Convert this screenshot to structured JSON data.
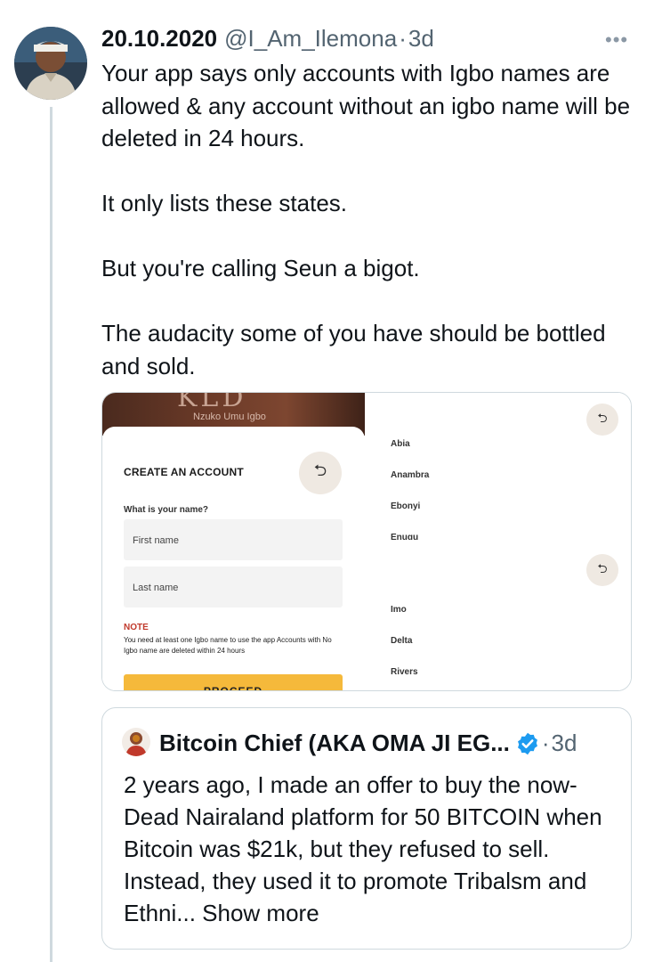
{
  "tweet": {
    "display_name": "20.10.2020",
    "handle": "@I_Am_Ilemona",
    "separator": "·",
    "time": "3d",
    "more_icon": "more-horizontal-icon",
    "paragraphs": [
      "Your app says only accounts with Igbo names are allowed & any account without an igbo name will be deleted in 24 hours.",
      "It only lists these states.",
      "But you're calling Seun a bigot.",
      "The audacity some of you have should be bottled and sold."
    ]
  },
  "media": {
    "left": {
      "hero_logo": "KLD",
      "hero_subtitle": "Nzuko Umu Igbo",
      "title": "CREATE AN ACCOUNT",
      "question": "What is your name?",
      "first_name_placeholder": "First name",
      "last_name_placeholder": "Last name",
      "note_title": "NOTE",
      "note_text": "You need at least one Igbo name to use the app Accounts with No Igbo name are deleted within 24 hours",
      "proceed_label": "PROCEED",
      "back_icon": "back-arrow-icon"
    },
    "right": {
      "states": [
        "Abia",
        "Anambra",
        "Ebonyi",
        "Enugu",
        "Imo",
        "Delta",
        "Rivers"
      ],
      "back_icon": "back-arrow-icon"
    }
  },
  "quote": {
    "display_name": "Bitcoin Chief (AKA OMA JI EG...",
    "verified_icon": "verified-badge-icon",
    "separator": "·",
    "time": "3d",
    "body": "2 years ago, I made an offer to buy the now-Dead Nairaland platform for 50 BITCOIN when Bitcoin was $21k, but they refused to sell. Instead, they used it to promote Tribalsm and Ethni...",
    "show_more": "Show more"
  },
  "colors": {
    "text": "#0f1419",
    "secondary": "#536471",
    "border": "#cfd9de",
    "verified": "#1d9bf0",
    "proceed": "#f5b93b",
    "note": "#c0392b"
  }
}
